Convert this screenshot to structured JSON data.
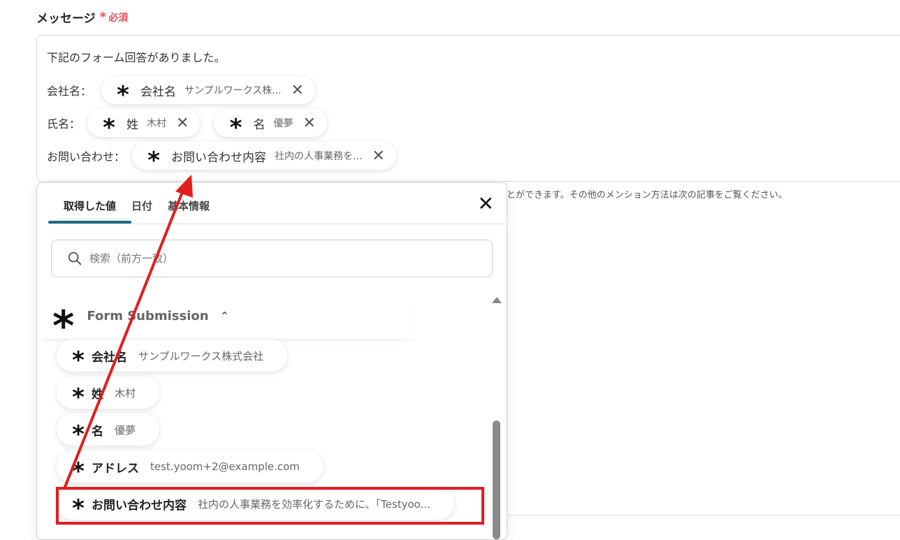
{
  "field": {
    "label": "メッセージ",
    "required_mark": "*",
    "required_text": "必須"
  },
  "message": {
    "intro": "下記のフォーム回答がありました。",
    "rows": [
      {
        "label": "会社名：",
        "chips": [
          {
            "name": "会社名",
            "value": "サンプルワークス株...",
            "remove": "✕"
          }
        ]
      },
      {
        "label": "氏名：",
        "chips": [
          {
            "name": "姓",
            "value": "木村",
            "remove": "✕"
          },
          {
            "name": "名",
            "value": "優夢",
            "remove": "✕"
          }
        ]
      },
      {
        "label": "お問い合わせ：",
        "chips": [
          {
            "name": "お問い合わせ内容",
            "value": "社内の人事業務を...",
            "remove": "✕"
          }
        ]
      }
    ]
  },
  "help_text": "とができます。その他のメンション方法は次の記事をご覧ください。",
  "picker": {
    "tabs": [
      {
        "label": "取得した値",
        "active": true
      },
      {
        "label": "日付",
        "active": false
      },
      {
        "label": "基本情報",
        "active": false
      }
    ],
    "close": "✕",
    "search_placeholder": "検索（前方一致）",
    "group": {
      "title": "Form Submission",
      "chevron": "⌃"
    },
    "options": [
      {
        "label": "会社名",
        "value": "サンプルワークス株式会社"
      },
      {
        "label": "姓",
        "value": "木村"
      },
      {
        "label": "名",
        "value": "優夢"
      },
      {
        "label": "アドレス",
        "value": "test.yoom+2@example.com"
      },
      {
        "label": "お問い合わせ内容",
        "value": "社内の人事業務を効率化するために、「Testyoo..."
      }
    ]
  },
  "icons": {
    "field_icon": "asterisk-icon",
    "search": "search-icon",
    "remove": "close-icon"
  },
  "colors": {
    "required": "#e8505b",
    "tab_underline": "#1b6b82",
    "annotation": "#e01e1e"
  }
}
